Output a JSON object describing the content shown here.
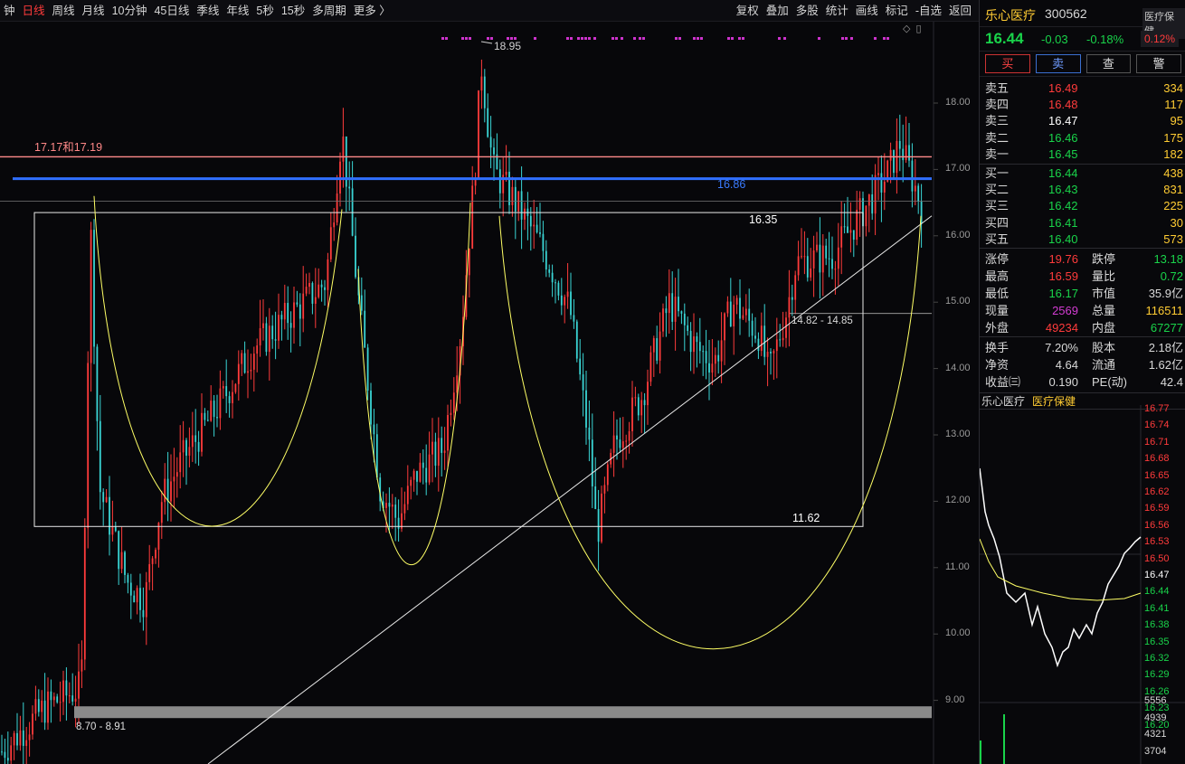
{
  "toolbar": {
    "period_tabs": [
      "钟",
      "日线",
      "周线",
      "月线",
      "10分钟",
      "45日线",
      "季线",
      "年线",
      "5秒",
      "15秒",
      "多周期",
      "更多 〉"
    ],
    "active_tab": "日线",
    "tool_tabs": [
      "复权",
      "叠加",
      "多股",
      "统计",
      "画线",
      "标记",
      "-自选",
      "返回"
    ]
  },
  "chart": {
    "price_axis_labels": [
      "18.00",
      "17.00",
      "16.00",
      "15.00",
      "14.00",
      "13.00",
      "12.00",
      "11.00",
      "10.00",
      "9.00"
    ],
    "annotations": {
      "resistance": "17.17和17.19",
      "blue_line": "16.86",
      "box_top": "16.35",
      "box_bottom": "11.62",
      "high": "18.95",
      "gap_zone": "14.82 - 14.85",
      "support_zone": "8.70 - 8.91"
    },
    "colors": {
      "up": "#ff3b3b",
      "down": "#3ad5d5",
      "blue_line": "#2f6fff",
      "resistance_line": "#ff8a8a",
      "arc": "#ffff66",
      "marker": "#cc33cc"
    }
  },
  "stock": {
    "name": "乐心医疗",
    "code": "300562",
    "sector_badge": "医疗保健",
    "last_price": "16.44",
    "change": "-0.03",
    "change_pct": "-0.18%",
    "pct_badge": "0.12%",
    "buttons": [
      "买",
      "卖",
      "查",
      "警"
    ]
  },
  "order_book": {
    "asks": [
      {
        "label": "卖五",
        "price": "16.49",
        "vol": "334"
      },
      {
        "label": "卖四",
        "price": "16.48",
        "vol": "117"
      },
      {
        "label": "卖三",
        "price": "16.47",
        "vol": "95"
      },
      {
        "label": "卖二",
        "price": "16.46",
        "vol": "175"
      },
      {
        "label": "卖一",
        "price": "16.45",
        "vol": "182"
      }
    ],
    "bids": [
      {
        "label": "买一",
        "price": "16.44",
        "vol": "438"
      },
      {
        "label": "买二",
        "price": "16.43",
        "vol": "831"
      },
      {
        "label": "买三",
        "price": "16.42",
        "vol": "225"
      },
      {
        "label": "买四",
        "price": "16.41",
        "vol": "30"
      },
      {
        "label": "买五",
        "price": "16.40",
        "vol": "573"
      }
    ]
  },
  "stats": {
    "block1": [
      {
        "l1": "涨停",
        "v1": "19.76",
        "c1": "#ff3b3b",
        "l2": "跌停",
        "v2": "13.18",
        "c2": "#19d34a"
      },
      {
        "l1": "最高",
        "v1": "16.59",
        "c1": "#ff3b3b",
        "l2": "量比",
        "v2": "0.72",
        "c2": "#19d34a"
      },
      {
        "l1": "最低",
        "v1": "16.17",
        "c1": "#19d34a",
        "l2": "市值",
        "v2": "35.9亿",
        "c2": "#d8d8d8"
      },
      {
        "l1": "现量",
        "v1": "2569",
        "c1": "#d33cd3",
        "l2": "总量",
        "v2": "116511",
        "c2": "#ffcc33"
      },
      {
        "l1": "外盘",
        "v1": "49234",
        "c1": "#ff3b3b",
        "l2": "内盘",
        "v2": "67277",
        "c2": "#19d34a"
      }
    ],
    "block2": [
      {
        "l1": "换手",
        "v1": "7.20%",
        "c1": "#d8d8d8",
        "l2": "股本",
        "v2": "2.18亿",
        "c2": "#d8d8d8"
      },
      {
        "l1": "净资",
        "v1": "4.64",
        "c1": "#d8d8d8",
        "l2": "流通",
        "v2": "1.62亿",
        "c2": "#d8d8d8"
      },
      {
        "l1": "收益㈢",
        "v1": "0.190",
        "c1": "#d8d8d8",
        "l2": "PE(动)",
        "v2": "42.4",
        "c2": "#d8d8d8"
      }
    ]
  },
  "minute_chart": {
    "name": "乐心医疗",
    "sector": "医疗保健",
    "price_labels": [
      "16.77",
      "16.74",
      "16.71",
      "16.68",
      "16.65",
      "16.62",
      "16.59",
      "16.56",
      "16.53",
      "16.50",
      "16.47",
      "16.44",
      "16.41",
      "16.38",
      "16.35",
      "16.32",
      "16.29",
      "16.26",
      "16.23",
      "16.20"
    ],
    "volume_labels": [
      "5556",
      "4939",
      "4321",
      "3704"
    ]
  }
}
